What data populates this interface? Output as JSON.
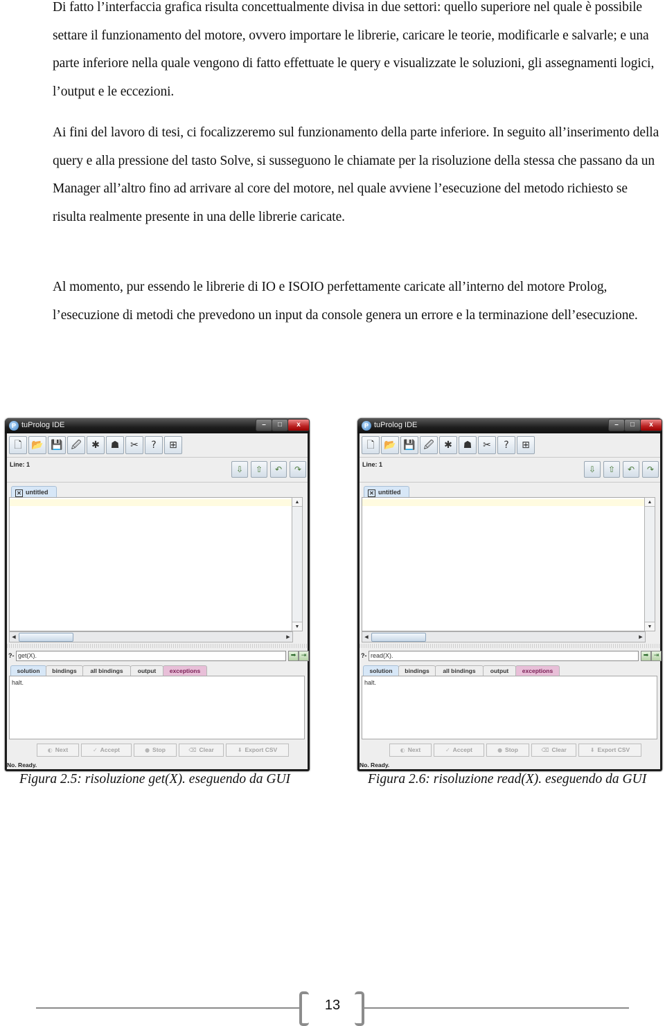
{
  "paragraphs": [
    "Di fatto l’interfaccia grafica risulta concettualmente divisa in due settori: quello superiore nel quale è possibile settare il funzionamento del motore, ovvero importare le librerie, caricare le teorie, modificarle e salvarle; e una parte inferiore nella quale vengono di fatto effettuate le query e visualizzate le soluzioni, gli assegnamenti logici, l’output e le eccezioni.",
    "Ai fini del lavoro di tesi, ci focalizzeremo sul funzionamento della parte inferiore. In seguito all’inserimento della query e alla pressione del tasto Solve, si susseguono le chiamate per la risoluzione della stessa che passano da un Manager all’altro fino ad arrivare al core del motore, nel quale avviene l’esecuzione del metodo richiesto se risulta realmente presente in una delle librerie caricate.",
    "Al momento, pur essendo le librerie di IO e ISOIO perfettamente caricate all’interno del motore Prolog, l’esecuzione di metodi che prevedono un input da console genera un errore e la terminazione dell’esecuzione."
  ],
  "windows": [
    {
      "title": "tuProlog IDE",
      "app_icon": "P",
      "controls": {
        "minimize": "–",
        "maximize": "□",
        "close": "x"
      },
      "toolbar_icons": [
        {
          "name": "new-file-icon",
          "glyph": "🗋"
        },
        {
          "name": "open-folder-icon",
          "glyph": "📂"
        },
        {
          "name": "save-icon",
          "glyph": "💾"
        },
        {
          "name": "save-as-icon",
          "glyph": "🖉"
        },
        {
          "name": "library-puzzle-icon",
          "glyph": "✱"
        },
        {
          "name": "debug-bug-icon",
          "glyph": "☗"
        },
        {
          "name": "tools-icon",
          "glyph": "✂"
        },
        {
          "name": "help-icon",
          "glyph": "?"
        },
        {
          "name": "network-icon",
          "glyph": "⊞"
        }
      ],
      "line_label": "Line: 1",
      "nav_icons": [
        {
          "name": "import-down-icon",
          "glyph": "⇩"
        },
        {
          "name": "export-up-icon",
          "glyph": "⇧"
        },
        {
          "name": "undo-icon",
          "glyph": "↶"
        },
        {
          "name": "redo-icon",
          "glyph": "↷"
        }
      ],
      "editor_tab": {
        "close": "✕",
        "label": "untitled"
      },
      "scroll": {
        "up": "▲",
        "down": "▼",
        "left": "◀",
        "right": "▶"
      },
      "query": {
        "prompt": "?-",
        "value": "get(X).",
        "solve_icon": "➡",
        "solve_all_icon": "⇥"
      },
      "result_tabs": [
        "solution",
        "bindings",
        "all bindings",
        "output",
        "exceptions"
      ],
      "active_result_tab": "solution",
      "result_text": "halt.",
      "actions": [
        {
          "label": "Next",
          "icon": "◐"
        },
        {
          "label": "Accept",
          "icon": "✓"
        },
        {
          "label": "Stop",
          "icon": "●"
        },
        {
          "label": "Clear",
          "icon": "⌫"
        },
        {
          "label": "Export CSV",
          "icon": "⬇"
        }
      ],
      "status": "No. Ready."
    },
    {
      "title": "tuProlog IDE",
      "app_icon": "P",
      "controls": {
        "minimize": "–",
        "maximize": "□",
        "close": "x"
      },
      "toolbar_icons": [
        {
          "name": "new-file-icon",
          "glyph": "🗋"
        },
        {
          "name": "open-folder-icon",
          "glyph": "📂"
        },
        {
          "name": "save-icon",
          "glyph": "💾"
        },
        {
          "name": "save-as-icon",
          "glyph": "🖉"
        },
        {
          "name": "library-puzzle-icon",
          "glyph": "✱"
        },
        {
          "name": "debug-bug-icon",
          "glyph": "☗"
        },
        {
          "name": "tools-icon",
          "glyph": "✂"
        },
        {
          "name": "help-icon",
          "glyph": "?"
        },
        {
          "name": "network-icon",
          "glyph": "⊞"
        }
      ],
      "line_label": "Line: 1",
      "nav_icons": [
        {
          "name": "import-down-icon",
          "glyph": "⇩"
        },
        {
          "name": "export-up-icon",
          "glyph": "⇧"
        },
        {
          "name": "undo-icon",
          "glyph": "↶"
        },
        {
          "name": "redo-icon",
          "glyph": "↷"
        }
      ],
      "editor_tab": {
        "close": "✕",
        "label": "untitled"
      },
      "scroll": {
        "up": "▲",
        "down": "▼",
        "left": "◀",
        "right": "▶"
      },
      "query": {
        "prompt": "?-",
        "value": "read(X).",
        "solve_icon": "➡",
        "solve_all_icon": "⇥"
      },
      "result_tabs": [
        "solution",
        "bindings",
        "all bindings",
        "output",
        "exceptions"
      ],
      "active_result_tab": "solution",
      "result_text": "halt.",
      "actions": [
        {
          "label": "Next",
          "icon": "◐"
        },
        {
          "label": "Accept",
          "icon": "✓"
        },
        {
          "label": "Stop",
          "icon": "●"
        },
        {
          "label": "Clear",
          "icon": "⌫"
        },
        {
          "label": "Export CSV",
          "icon": "⬇"
        }
      ],
      "status": "No. Ready."
    }
  ],
  "captions": [
    "Figura 2.5: risoluzione get(X). eseguendo da GUI",
    "Figura 2.6: risoluzione read(X). eseguendo da GUI"
  ],
  "footer": {
    "page_number": "13"
  }
}
